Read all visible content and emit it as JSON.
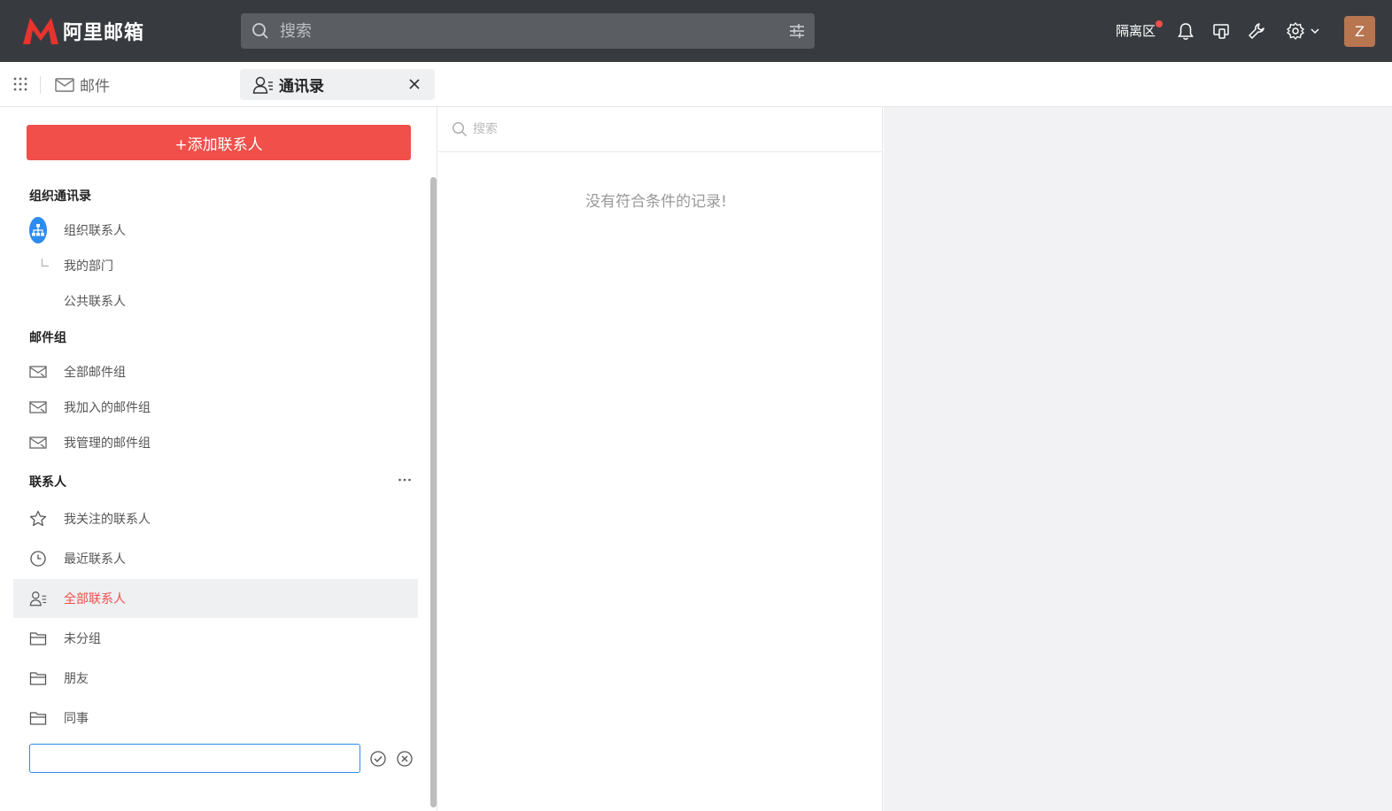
{
  "brand": {
    "name": "阿里邮箱"
  },
  "top_search": {
    "placeholder": "搜索"
  },
  "header": {
    "quarantine_label": "隔离区",
    "avatar_initial": "Z"
  },
  "tabs": {
    "mail_label": "邮件",
    "contacts_label": "通讯录"
  },
  "sidebar": {
    "add_contact_label": "+添加联系人",
    "org_section": {
      "title": "组织通讯录",
      "items": [
        "组织联系人",
        "我的部门",
        "公共联系人"
      ]
    },
    "group_section": {
      "title": "邮件组",
      "items": [
        "全部邮件组",
        "我加入的邮件组",
        "我管理的邮件组"
      ]
    },
    "contact_section": {
      "title": "联系人",
      "items": [
        "我关注的联系人",
        "最近联系人",
        "全部联系人",
        "未分组",
        "朋友",
        "同事"
      ]
    },
    "active_item": "全部联系人",
    "new_group_input_value": ""
  },
  "middle": {
    "search_placeholder": "搜索",
    "empty_text": "没有符合条件的记录!"
  },
  "colors": {
    "accent": "#f04f4a",
    "topbar": "#373b40",
    "link_blue": "#2d8cf0"
  }
}
